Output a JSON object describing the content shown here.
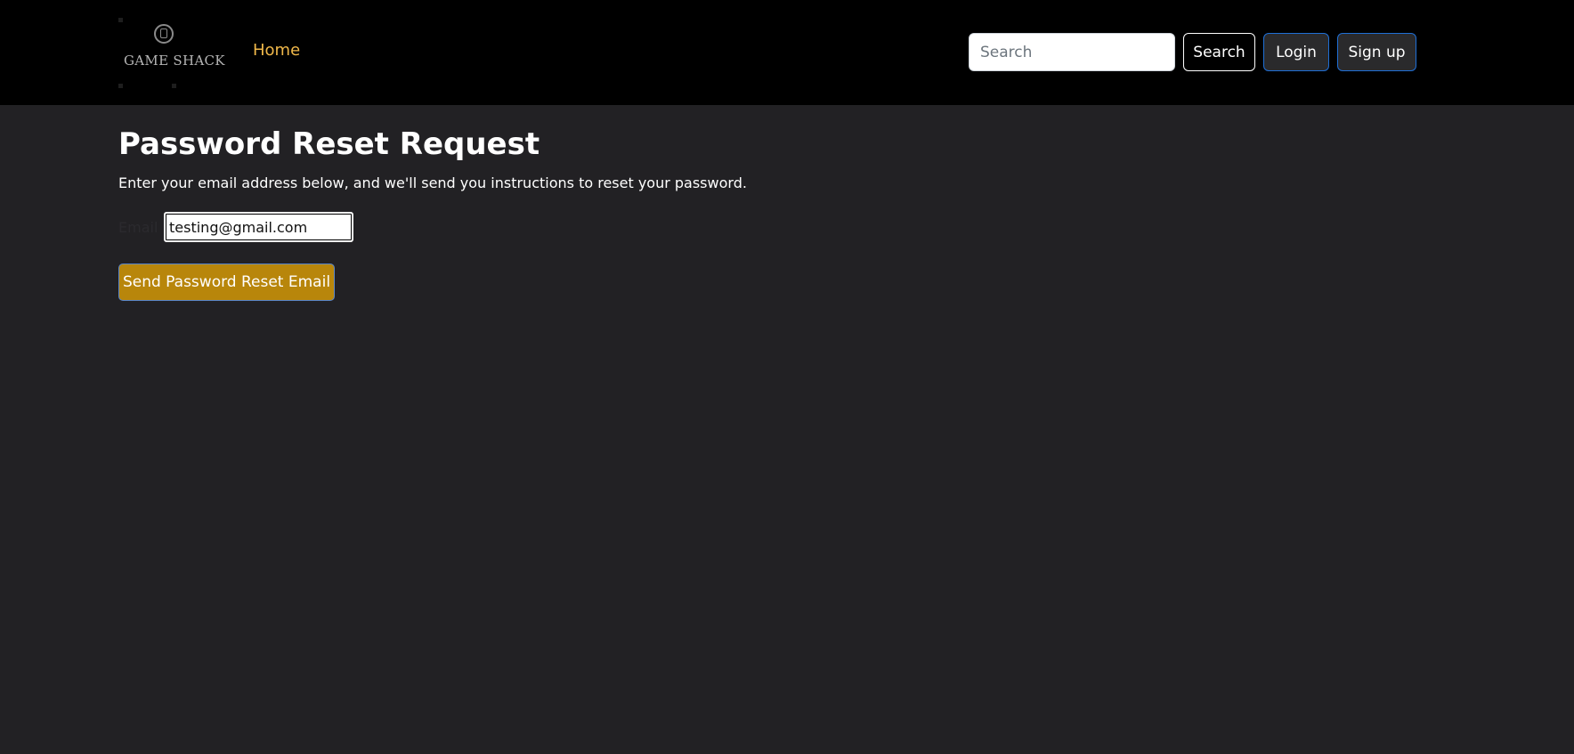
{
  "header": {
    "logo_text": "GAME SHACK",
    "nav_home_label": "Home",
    "search_placeholder": "Search",
    "search_button_label": "Search",
    "login_button_label": "Login",
    "signup_button_label": "Sign up"
  },
  "main": {
    "title": "Password Reset Request",
    "description": "Enter your email address below, and we'll send you instructions to reset your password.",
    "email_label": "Email",
    "email_value": "testing@gmail.com",
    "submit_button_label": "Send Password Reset Email"
  },
  "colors": {
    "background": "#222124",
    "navbar": "#000000",
    "nav_link": "#f0b84a",
    "submit_button": "#b8860b",
    "auth_button_border": "#1f6fd6"
  },
  "icons": {
    "logo": "game-controller-badge-icon"
  }
}
